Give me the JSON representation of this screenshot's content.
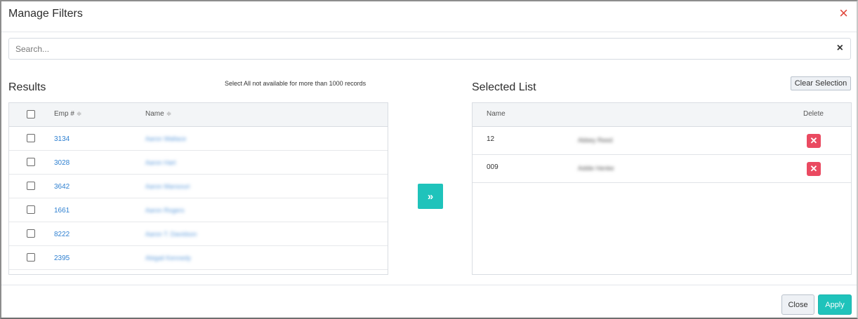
{
  "modal": {
    "title": "Manage Filters",
    "close_icon": "×"
  },
  "search": {
    "placeholder": "Search...",
    "value": "",
    "clear_icon": "×"
  },
  "results": {
    "title": "Results",
    "note": "Select All not available for more than 1000 records",
    "columns": [
      "Emp #",
      "Name"
    ],
    "sort_icon": "≑",
    "rows": [
      {
        "emp": "3134",
        "name": "Aaron Wallace"
      },
      {
        "emp": "3028",
        "name": "Aaron Hart"
      },
      {
        "emp": "3642",
        "name": "Aaron Mansouri"
      },
      {
        "emp": "1661",
        "name": "Aaron Rogers"
      },
      {
        "emp": "8222",
        "name": "Aaron T. Davidson"
      },
      {
        "emp": "2395",
        "name": "Abigail Kennedy"
      }
    ]
  },
  "transfer_icon": "»",
  "selected": {
    "title": "Selected List",
    "clear_label": "Clear Selection",
    "columns": [
      "Name",
      "Delete"
    ],
    "rows": [
      {
        "id": "12",
        "name": "Abbey Reed"
      },
      {
        "id": "009",
        "name": "Addie Henke"
      }
    ],
    "delete_icon": "✕"
  },
  "footer": {
    "close_label": "Close",
    "apply_label": "Apply"
  },
  "colors": {
    "accent": "#1fc3bb",
    "danger": "#ea4a61",
    "link": "#2f80d1"
  }
}
